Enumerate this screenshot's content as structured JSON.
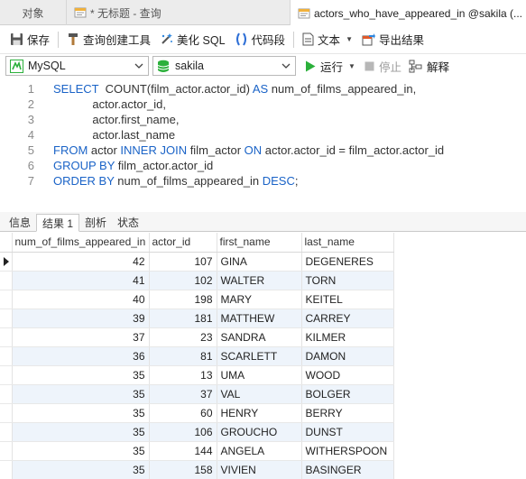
{
  "tabs": {
    "objects": "对象",
    "untitled_query": "* 无标题 - 查询",
    "active_query": "actors_who_have_appeared_in @sakila (..."
  },
  "toolbar": {
    "save": "保存",
    "query_builder": "查询创建工具",
    "beautify_sql": "美化 SQL",
    "code_snippet": "代码段",
    "text": "文本",
    "export_results": "导出结果"
  },
  "connection": {
    "db_type": "MySQL",
    "database": "sakila",
    "run": "运行",
    "stop": "停止",
    "explain": "解释"
  },
  "editor": {
    "lines": [
      {
        "n": "1",
        "parts": [
          [
            "kw",
            "SELECT "
          ],
          [
            "t",
            " COUNT(film_actor.actor_id) "
          ],
          [
            "kw",
            "AS"
          ],
          [
            "t",
            " num_of_films_appeared_in,"
          ]
        ]
      },
      {
        "n": "2",
        "parts": [
          [
            "t",
            "            actor.actor_id,"
          ]
        ]
      },
      {
        "n": "3",
        "parts": [
          [
            "t",
            "            actor.first_name,"
          ]
        ]
      },
      {
        "n": "4",
        "parts": [
          [
            "t",
            "            actor.last_name"
          ]
        ]
      },
      {
        "n": "5",
        "parts": [
          [
            "kw",
            "FROM"
          ],
          [
            "t",
            " actor "
          ],
          [
            "kw",
            "INNER JOIN"
          ],
          [
            "t",
            " film_actor "
          ],
          [
            "kw",
            "ON"
          ],
          [
            "t",
            " actor.actor_id = film_actor.actor_id"
          ]
        ]
      },
      {
        "n": "6",
        "parts": [
          [
            "kw",
            "GROUP BY"
          ],
          [
            "t",
            " film_actor.actor_id"
          ]
        ]
      },
      {
        "n": "7",
        "parts": [
          [
            "kw",
            "ORDER BY"
          ],
          [
            "t",
            " num_of_films_appeared_in "
          ],
          [
            "kw",
            "DESC"
          ],
          [
            "t",
            ";"
          ]
        ]
      }
    ]
  },
  "result_tabs": {
    "info": "信息",
    "result1": "结果 1",
    "profile": "剖析",
    "status": "状态"
  },
  "grid": {
    "columns": [
      "num_of_films_appeared_in",
      "actor_id",
      "first_name",
      "last_name"
    ],
    "rows": [
      [
        "42",
        "107",
        "GINA",
        "DEGENERES"
      ],
      [
        "41",
        "102",
        "WALTER",
        "TORN"
      ],
      [
        "40",
        "198",
        "MARY",
        "KEITEL"
      ],
      [
        "39",
        "181",
        "MATTHEW",
        "CARREY"
      ],
      [
        "37",
        "23",
        "SANDRA",
        "KILMER"
      ],
      [
        "36",
        "81",
        "SCARLETT",
        "DAMON"
      ],
      [
        "35",
        "13",
        "UMA",
        "WOOD"
      ],
      [
        "35",
        "37",
        "VAL",
        "BOLGER"
      ],
      [
        "35",
        "60",
        "HENRY",
        "BERRY"
      ],
      [
        "35",
        "106",
        "GROUCHO",
        "DUNST"
      ],
      [
        "35",
        "144",
        "ANGELA",
        "WITHERSPOON"
      ],
      [
        "35",
        "158",
        "VIVIEN",
        "BASINGER"
      ]
    ]
  },
  "colors": {
    "keyword": "#1a63c7",
    "row_alt": "#eef4fb",
    "run_green": "#2bb03b"
  }
}
